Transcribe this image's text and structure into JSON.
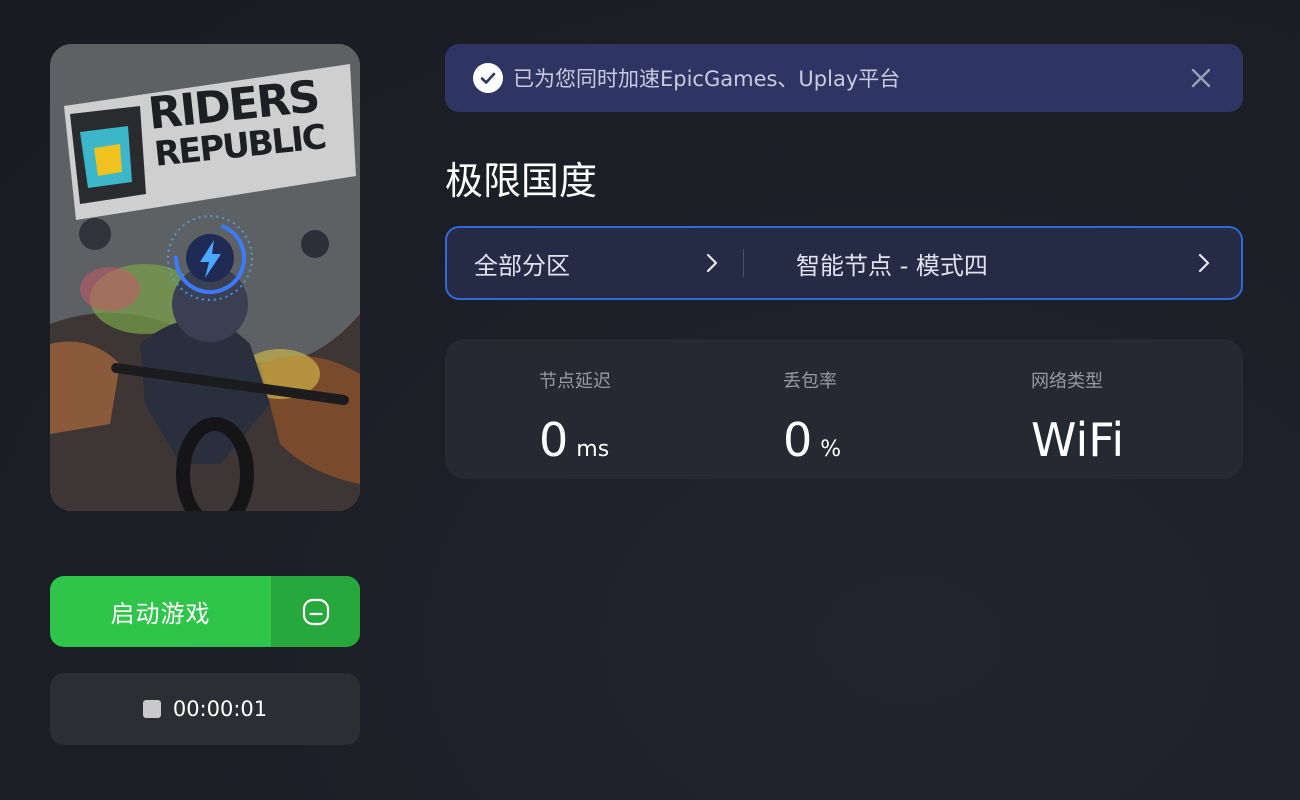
{
  "game": {
    "cover_title_line1": "RIDERS",
    "cover_title_line2": "REPUBLIC",
    "name": "极限国度"
  },
  "notice": {
    "text": "已为您同时加速EpicGames、Uplay平台"
  },
  "selector": {
    "region": "全部分区",
    "node": "智能节点 - 模式四"
  },
  "stats": {
    "latency": {
      "label": "节点延迟",
      "value": "0",
      "unit": "ms"
    },
    "packet_loss": {
      "label": "丢包率",
      "value": "0",
      "unit": "%"
    },
    "network": {
      "label": "网络类型",
      "value": "WiFi"
    }
  },
  "actions": {
    "launch_label": "启动游戏",
    "timer": "00:00:01"
  },
  "colors": {
    "launch_green": "#2fc54a",
    "notice_bg": "#2e3563",
    "selector_border": "#2f6ad8",
    "accent_blue": "#3a7bff"
  },
  "icons": [
    "check-icon",
    "close-icon",
    "chevron-right-icon",
    "lightning-icon",
    "minus-circle-icon",
    "stop-icon"
  ]
}
